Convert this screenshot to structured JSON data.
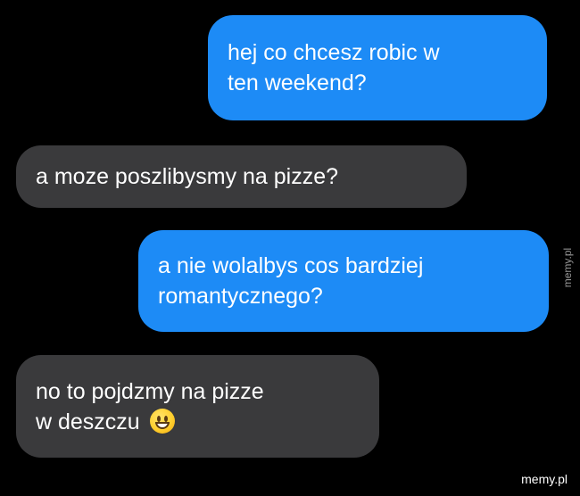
{
  "conversation": {
    "messages": [
      {
        "sender": "me",
        "text": "hej co chcesz robic w\nten weekend?"
      },
      {
        "sender": "them",
        "text": "a moze poszlibysmy na pizze?"
      },
      {
        "sender": "me",
        "text": "a nie wolalbys cos bardziej\nromantycznego?"
      },
      {
        "sender": "them",
        "text": "no to pojdzmy na pizze\nw deszczu",
        "emoji": "grinning-face-emoji"
      }
    ]
  },
  "colors": {
    "background": "#000000",
    "outgoing_bubble": "#1d8bf6",
    "incoming_bubble": "#3a3a3c",
    "text": "#ffffff"
  },
  "watermark": {
    "side_text": "memy.pl",
    "bottom_text": "memy.pl"
  }
}
